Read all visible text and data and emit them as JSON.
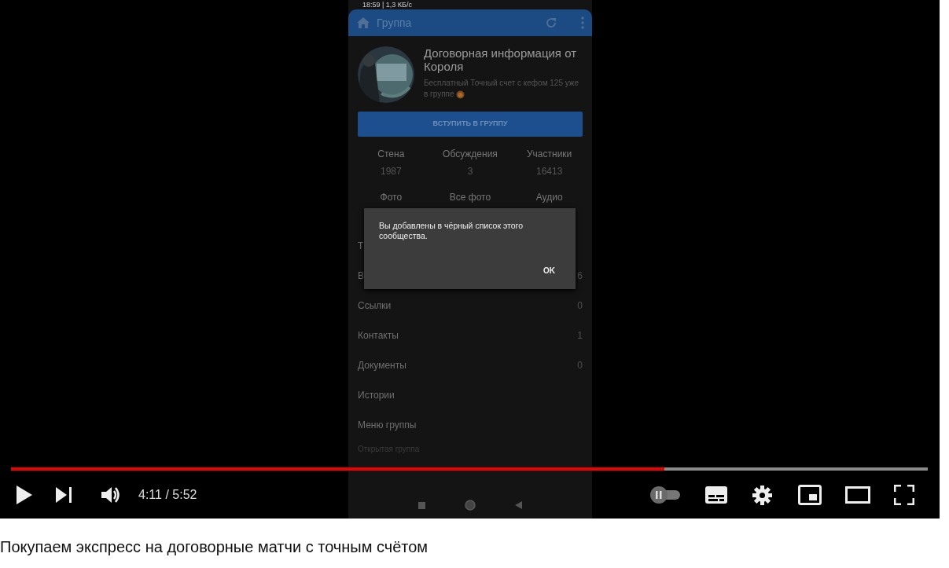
{
  "player": {
    "progress": {
      "level": 0.713
    },
    "time": "4:11 / 5:52",
    "autoplay": {
      "on": false
    }
  },
  "phone": {
    "status_bar": "18:59 | 1,3 КБ/с",
    "app_bar": {
      "title": "Группа"
    },
    "group": {
      "name": "Договорная информация от Короля",
      "status": "Бесплатный Точный счет с кефом 125 уже в группе"
    },
    "join_button": "ВСТУПИТЬ В ГРУППУ",
    "counters": [
      {
        "label": "Стена",
        "value": "1987"
      },
      {
        "label": "Обсуждения",
        "value": "3"
      },
      {
        "label": "Участники",
        "value": "16413"
      }
    ],
    "sections": [
      "Фото",
      "Все фото",
      "Аудио"
    ],
    "menu": [
      {
        "label": "Т"
      },
      {
        "label": "В",
        "count": "6"
      },
      {
        "label": "Ссылки",
        "count": "0"
      },
      {
        "label": "Контакты",
        "count": "1"
      },
      {
        "label": "Документы",
        "count": "0"
      },
      {
        "label": "Истории"
      },
      {
        "label": "Меню группы"
      }
    ],
    "footer": "Открытая группа",
    "dialog": {
      "message": "Вы добавлены в чёрный список этого сообщества.",
      "button": "OK"
    }
  },
  "video_title": "Покупаем экспресс на договорные матчи с точным счётом"
}
